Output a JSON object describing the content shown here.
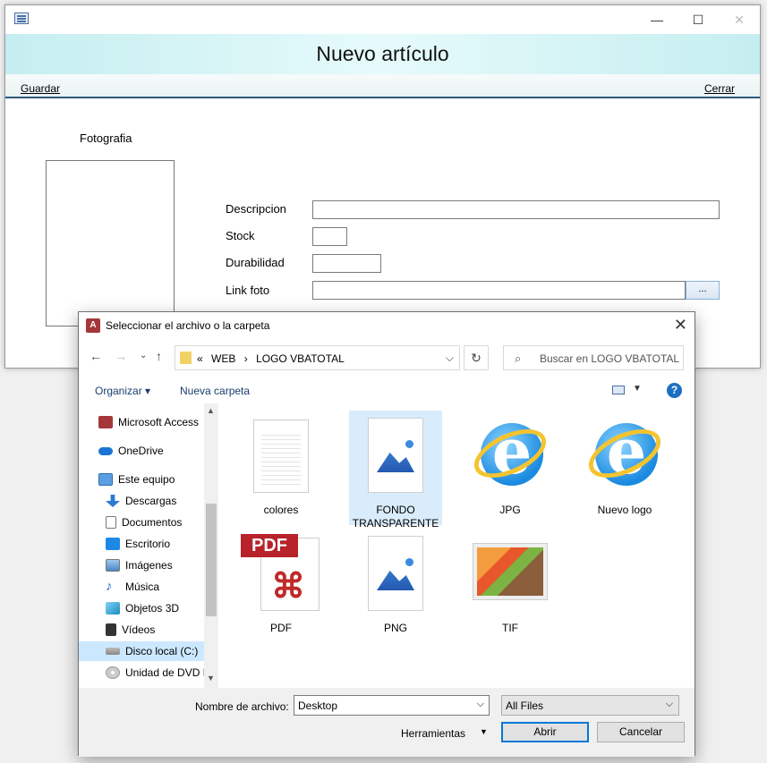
{
  "form": {
    "header_title": "Nuevo artículo",
    "toolbar": {
      "save_label": "Guardar",
      "close_label": "Cerrar"
    },
    "photo_label": "Fotografia",
    "fields": {
      "description_label": "Descripcion",
      "stock_label": "Stock",
      "durability_label": "Durabilidad",
      "photo_link_label": "Link foto",
      "browse_label": "..."
    },
    "window_controls": {
      "minimize": "—",
      "maximize": "☐",
      "close": "✕"
    }
  },
  "dialog": {
    "title": "Seleccionar el archivo o la carpeta",
    "icon_text": "A",
    "address": {
      "prefix": "«",
      "segments": [
        "WEB",
        "›",
        "LOGO VBATOTAL"
      ]
    },
    "search_placeholder": "Buscar en LOGO VBATOTAL",
    "commands": {
      "organize": "Organizar ▾",
      "new_folder": "Nueva carpeta",
      "help": "?"
    },
    "nav_items": [
      {
        "label": "Microsoft Access",
        "icon": "access-icon"
      },
      {
        "label": "OneDrive",
        "icon": "cloud-icon"
      },
      {
        "label": "Este equipo",
        "icon": "computer-icon"
      },
      {
        "label": "Descargas",
        "icon": "download-icon"
      },
      {
        "label": "Documentos",
        "icon": "document-icon"
      },
      {
        "label": "Escritorio",
        "icon": "desktop-icon"
      },
      {
        "label": "Imágenes",
        "icon": "pictures-icon"
      },
      {
        "label": "Música",
        "icon": "music-icon"
      },
      {
        "label": "Objetos 3D",
        "icon": "cube-icon"
      },
      {
        "label": "Vídeos",
        "icon": "video-icon"
      },
      {
        "label": "Disco local (C:)",
        "icon": "drive-icon",
        "selected": true
      },
      {
        "label": "Unidad de DVD F",
        "icon": "dvd-icon"
      }
    ],
    "files": [
      {
        "name": "colores",
        "type": "document"
      },
      {
        "name": "FONDO TRANSPARENTE",
        "type": "image",
        "selected": true
      },
      {
        "name": "JPG",
        "type": "ie"
      },
      {
        "name": "Nuevo logo",
        "type": "ie"
      },
      {
        "name": "PDF",
        "type": "pdf"
      },
      {
        "name": "PNG",
        "type": "image"
      },
      {
        "name": "TIF",
        "type": "tif"
      }
    ],
    "pdf_tag": "PDF",
    "file_name_label": "Nombre de archivo:",
    "file_name_value": "Desktop",
    "filter_value": "All Files",
    "tools_label": "Herramientas",
    "open_label": "Abrir",
    "cancel_label": "Cancelar",
    "close_glyph": "✕"
  },
  "colors": {
    "accent": "#0078d7",
    "header_bg": "#c5eef0",
    "selection": "#cce8ff"
  }
}
